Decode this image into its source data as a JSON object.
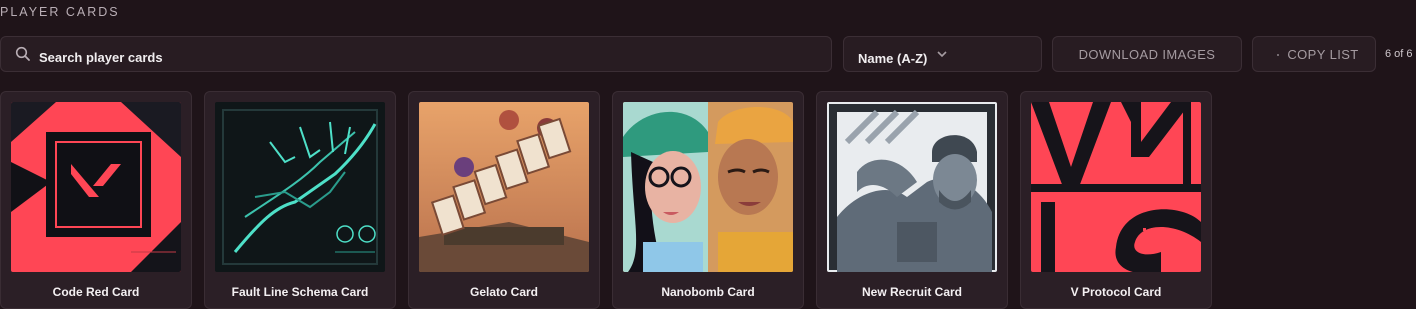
{
  "page": {
    "title": "PLAYER CARDS"
  },
  "search": {
    "placeholder": "Search player cards",
    "value": ""
  },
  "sort": {
    "selected": "Name (A-Z)"
  },
  "actions": {
    "download_label": "DOWNLOAD IMAGES",
    "copy_label": "COPY LIST"
  },
  "results": {
    "count_text": "6 of 6"
  },
  "cards": [
    {
      "name": "Code Red Card",
      "art": "valorant-logo-red-art"
    },
    {
      "name": "Fault Line Schema Card",
      "art": "wireframe-robot-hand-art"
    },
    {
      "name": "Gelato Card",
      "art": "gelato-sign-art"
    },
    {
      "name": "Nanobomb Card",
      "art": "two-agents-portrait-art"
    },
    {
      "name": "New Recruit Card",
      "art": "soldier-portrait-art"
    },
    {
      "name": "V Protocol Card",
      "art": "v-protocol-typography-art"
    }
  ],
  "colors": {
    "background": "#1f1419",
    "panel": "#281c22",
    "card": "#2b1f26",
    "accent_red": "#ff4655"
  }
}
